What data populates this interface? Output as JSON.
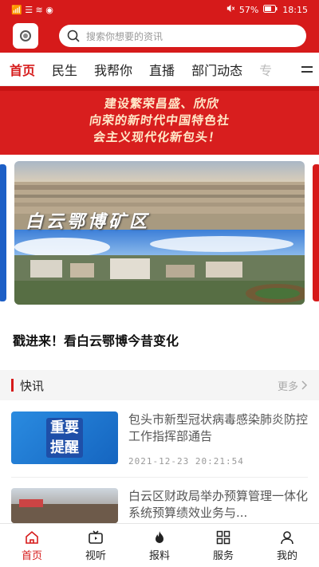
{
  "status_bar": {
    "left_icons": "📶 ☰ ≋ ◉",
    "battery": "57%",
    "time": "18:15"
  },
  "header": {
    "search_placeholder": "搜索你想要的资讯"
  },
  "tabs": [
    {
      "label": "首页"
    },
    {
      "label": "民生"
    },
    {
      "label": "我帮你"
    },
    {
      "label": "直播"
    },
    {
      "label": "部门动态"
    },
    {
      "label": "专"
    }
  ],
  "banner": {
    "line1": "建设繁荣昌盛、欣欣",
    "line2": "向荣的新时代中国特色社",
    "line3": "会主义现代化新包头！"
  },
  "carousel": {
    "slide_overlay_text": "白云鄂博矿区",
    "slide_title": "戳进来！看白云鄂博今昔变化"
  },
  "news_section": {
    "title": "快讯",
    "more_label": "更多"
  },
  "news": [
    {
      "thumb_line1": "重要",
      "thumb_line2": "提醒",
      "title": "包头市新型冠状病毒感染肺炎防控工作指挥部通告",
      "time": "2021-12-23 20:21:54"
    },
    {
      "title": "白云区财政局举办预算管理一体化系统预算绩效业务与..."
    }
  ],
  "bottom_nav": [
    {
      "label": "首页",
      "icon": "home-icon"
    },
    {
      "label": "视听",
      "icon": "tv-icon"
    },
    {
      "label": "报料",
      "icon": "flame-icon"
    },
    {
      "label": "服务",
      "icon": "grid-icon"
    },
    {
      "label": "我的",
      "icon": "user-icon"
    }
  ],
  "colors": {
    "brand_red": "#d61a1a",
    "text": "#222222",
    "muted": "#999999"
  }
}
